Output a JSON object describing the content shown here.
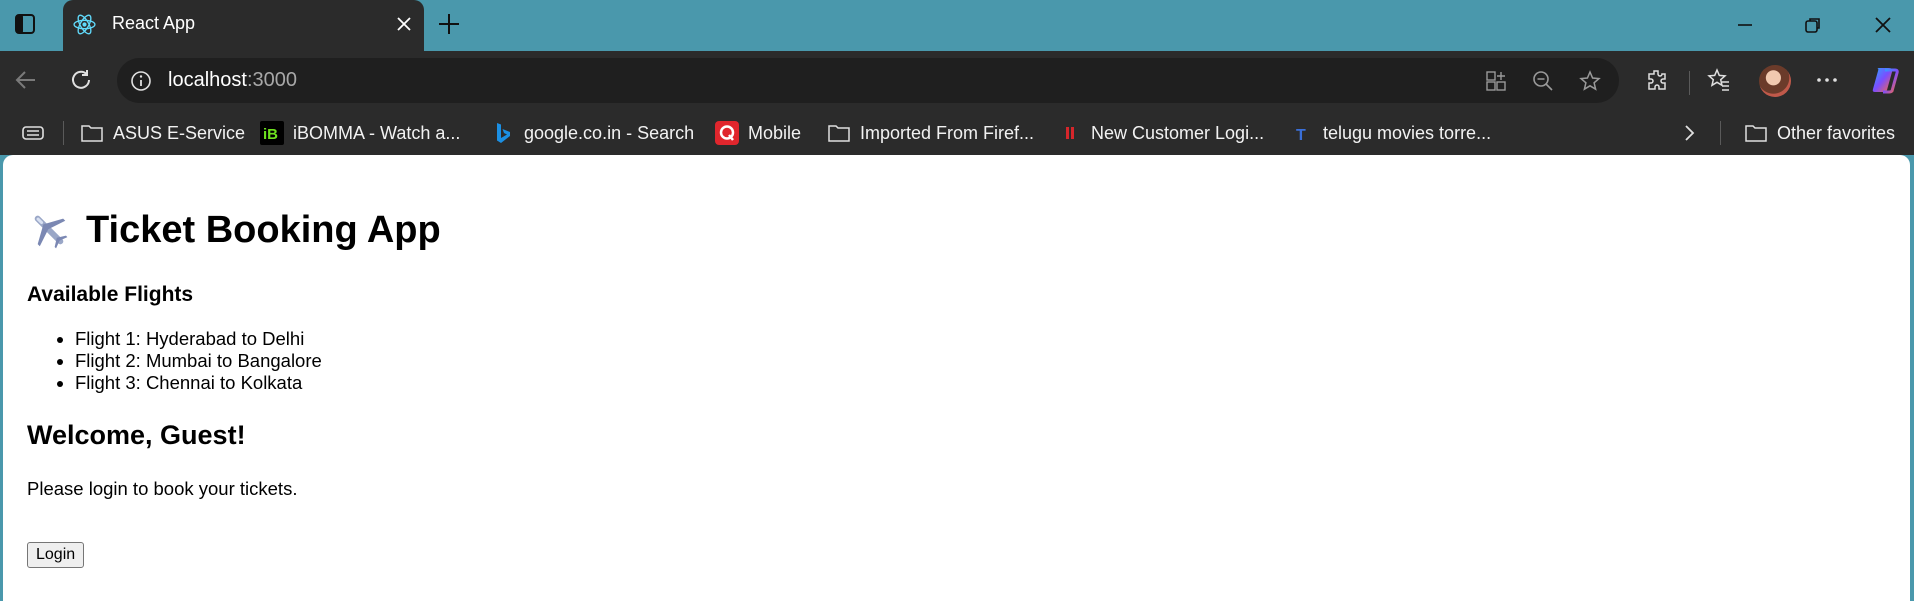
{
  "browser": {
    "tab": {
      "title": "React App"
    },
    "address": {
      "host": "localhost",
      "port": ":3000"
    },
    "bookmarks": [
      {
        "label": "ASUS E-Service",
        "icon": "folder-icon"
      },
      {
        "label": "iBOMMA - Watch a...",
        "icon": "ibomma-icon"
      },
      {
        "label": "google.co.in - Search",
        "icon": "bing-icon"
      },
      {
        "label": "Mobile",
        "icon": "q-icon"
      },
      {
        "label": "Imported From Firef...",
        "icon": "folder-icon"
      },
      {
        "label": "New Customer Logi...",
        "icon": "ii-icon"
      },
      {
        "label": "telugu movies torre...",
        "icon": "t-icon"
      }
    ],
    "other_favorites": "Other favorites",
    "colors": {
      "tabstrip": "#4a98ac",
      "toolbar": "#2b2b2b",
      "omnibox": "#1f1f1f"
    }
  },
  "page": {
    "title": "Ticket Booking App",
    "flights_heading": "Available Flights",
    "flights": [
      "Flight 1: Hyderabad to Delhi",
      "Flight 2: Mumbai to Bangalore",
      "Flight 3: Chennai to Kolkata"
    ],
    "welcome": "Welcome, Guest!",
    "login_message": "Please login to book your tickets.",
    "login_button": "Login"
  }
}
